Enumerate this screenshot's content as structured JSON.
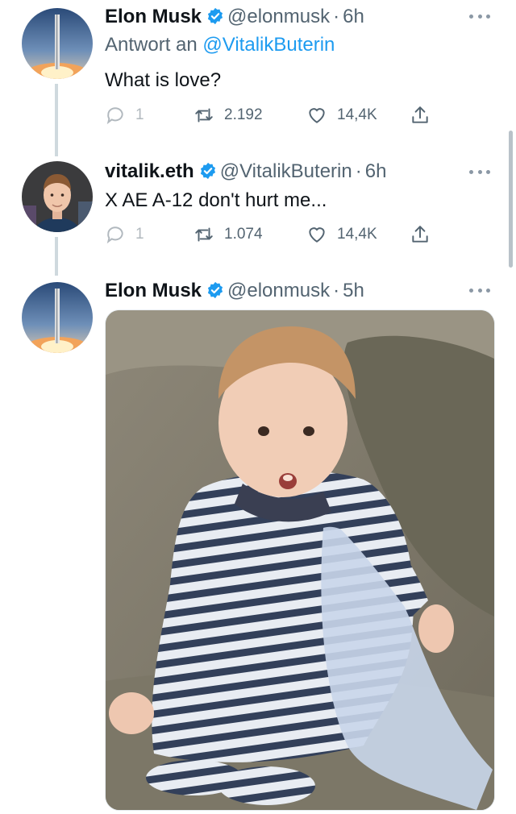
{
  "tweets": [
    {
      "name": "Elon Musk",
      "handle": "@elonmusk",
      "time": "6h",
      "reply_prefix": "Antwort an",
      "reply_handle": "@VitalikButerin",
      "text": "What is love?",
      "replies": "1",
      "retweets": "2.192",
      "likes": "14,4K",
      "avatar_icon": "rocket-launch-avatar"
    },
    {
      "name": "vitalik.eth",
      "handle": "@VitalikButerin",
      "time": "6h",
      "text": "X AE A-12 don't hurt me...",
      "replies": "1",
      "retweets": "1.074",
      "likes": "14,4K",
      "avatar_icon": "person-portrait-avatar"
    },
    {
      "name": "Elon Musk",
      "handle": "@elonmusk",
      "time": "5h",
      "media": "photo-toddler-on-couch",
      "avatar_icon": "rocket-launch-avatar"
    }
  ],
  "colors": {
    "accent": "#1d9bf0",
    "secondary_text": "#536471",
    "thread_line": "#cfd9de"
  }
}
